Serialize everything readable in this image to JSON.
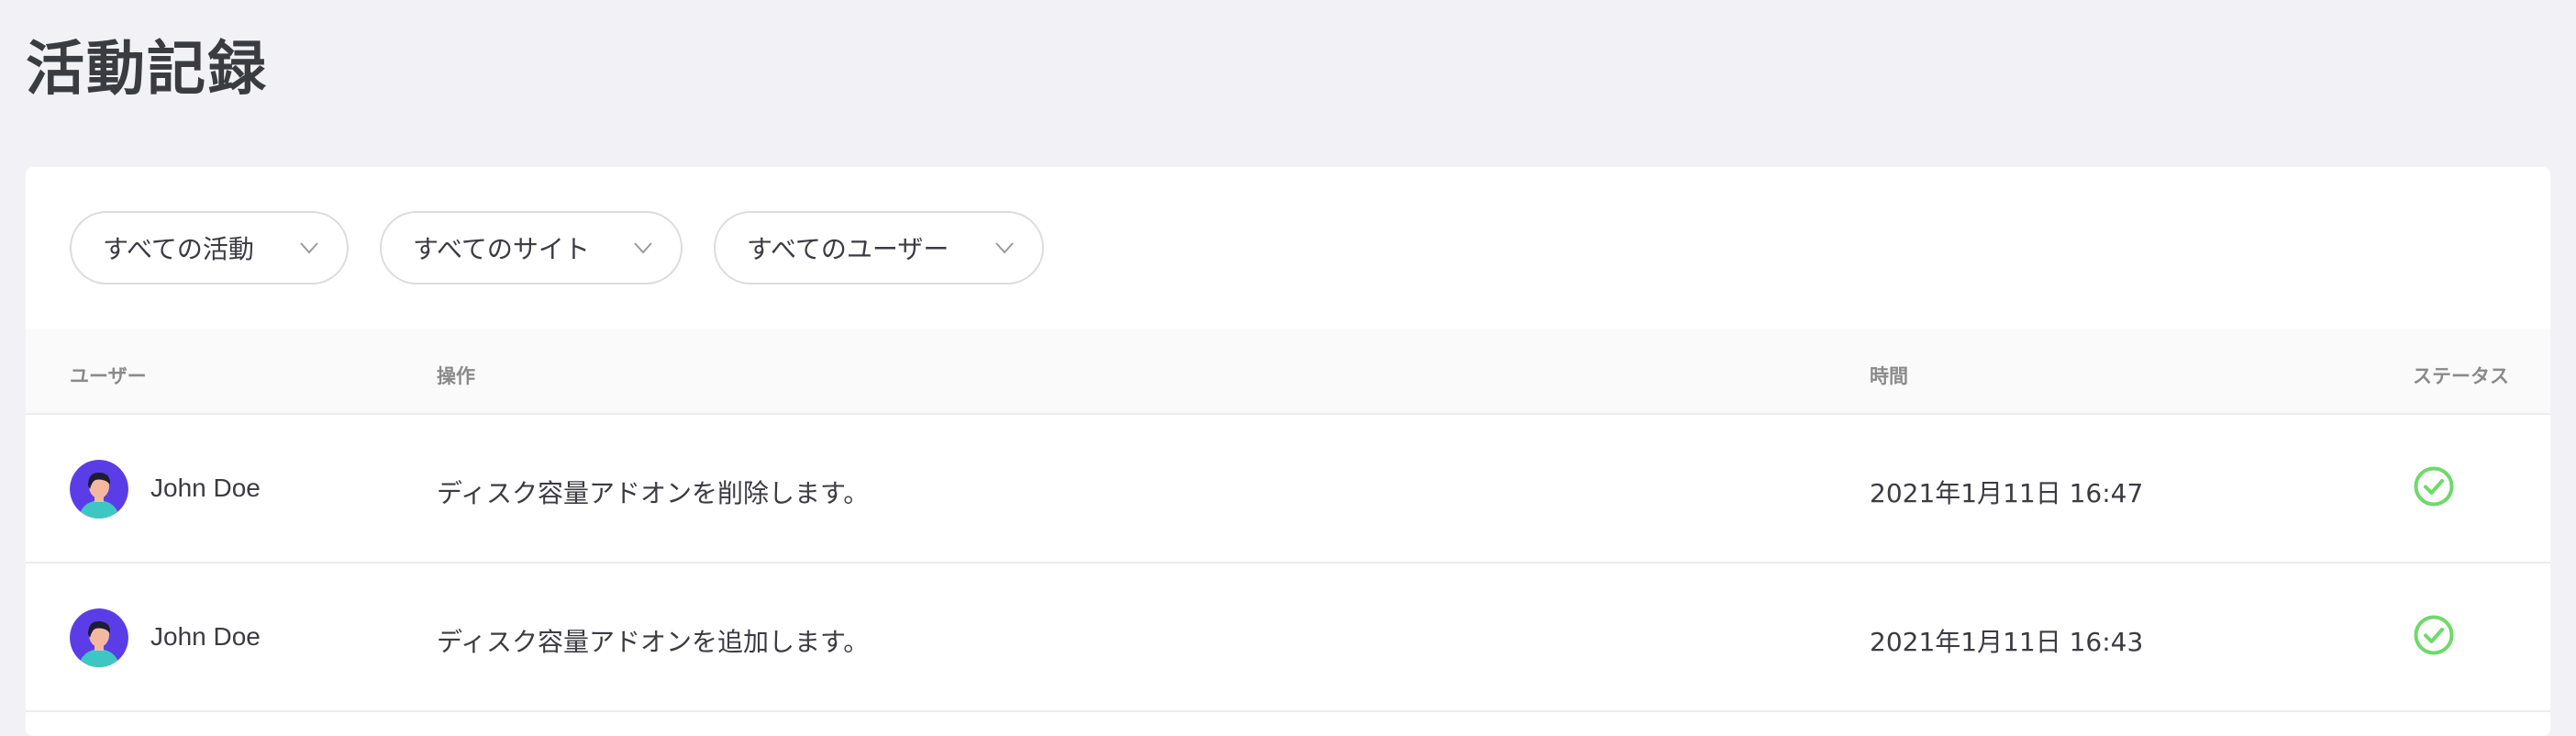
{
  "page": {
    "title": "活動記録"
  },
  "filters": [
    {
      "label": "すべての活動"
    },
    {
      "label": "すべてのサイト"
    },
    {
      "label": "すべてのユーザー"
    }
  ],
  "table": {
    "headers": {
      "user": "ユーザー",
      "operation": "操作",
      "time": "時間",
      "status": "ステータス"
    },
    "rows": [
      {
        "user": "John Doe",
        "operation": "ディスク容量アドオンを削除します。",
        "time": "2021年1月11日 16:47",
        "status": "success"
      },
      {
        "user": "John Doe",
        "operation": "ディスク容量アドオンを追加します。",
        "time": "2021年1月11日 16:43",
        "status": "success"
      }
    ]
  },
  "colors": {
    "accent_avatar": "#5b3de8",
    "status_success": "#6fd96a",
    "background": "#f2f2f6"
  },
  "icons": {
    "filter_chevron": "chevron-down-icon",
    "status": "check-circle-icon",
    "avatar": "user-avatar-icon"
  }
}
